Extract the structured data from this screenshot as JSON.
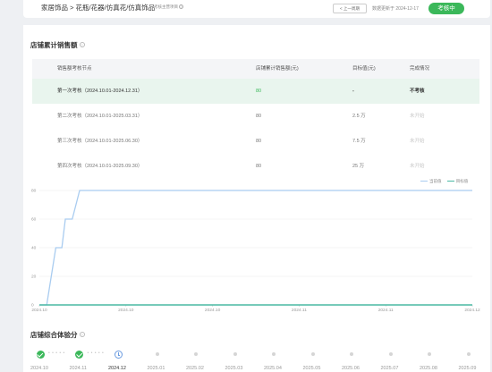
{
  "header": {
    "breadcrumb": "家居饰品 > 花瓶/花器/仿真花/仿真饰品",
    "hint_link": "考核主营项目",
    "prev_button": "< 上一周期",
    "update_text": "数据更新于 2024-12-17",
    "status_button": "考核中"
  },
  "sales_section": {
    "title": "店铺累计销售额",
    "columns": [
      "销售额考核节点",
      "店铺累计销售额(元)",
      "目标值(元)",
      "完成情况"
    ],
    "rows": [
      {
        "node": "第一次考核（2024.10.01-2024.12.31）",
        "sales": "80",
        "target": "-",
        "status": "不考核"
      },
      {
        "node": "第二次考核（2024.10.01-2025.03.31）",
        "sales": "80",
        "target": "2.5 万",
        "status": "未开始"
      },
      {
        "node": "第三次考核（2024.10.01-2025.06.30）",
        "sales": "80",
        "target": "7.5 万",
        "status": "未开始"
      },
      {
        "node": "第四次考核（2024.10.01-2025.09.30）",
        "sales": "80",
        "target": "25 万",
        "status": "未开始"
      }
    ]
  },
  "chart_data": {
    "type": "line",
    "x_tick_labels": [
      "2024.10",
      "2024.10",
      "2024.10",
      "2024.11",
      "2024.11",
      "2024.12"
    ],
    "y_ticks": [
      0,
      20,
      40,
      60,
      80
    ],
    "ylim": [
      0,
      80
    ],
    "legend": [
      "当前值",
      "目标值"
    ],
    "legend_position": "top-right",
    "grid": true,
    "series": [
      {
        "name": "当前值",
        "color": "#a9ccf0",
        "y": [
          0,
          0,
          40,
          40,
          60,
          60,
          80,
          80,
          80
        ]
      },
      {
        "name": "目标值",
        "color": "#4ab8a4",
        "y": [
          0,
          0,
          0,
          0,
          0,
          0,
          0,
          0,
          0
        ]
      }
    ]
  },
  "score_section": {
    "title": "店铺综合体验分",
    "timeline": [
      {
        "label": "2024.10",
        "state": "done"
      },
      {
        "label": "2024.11",
        "state": "done"
      },
      {
        "label": "2024.12",
        "state": "current"
      },
      {
        "label": "2025.01",
        "state": "future"
      },
      {
        "label": "2025.02",
        "state": "future"
      },
      {
        "label": "2025.03",
        "state": "future"
      },
      {
        "label": "2025.04",
        "state": "future"
      },
      {
        "label": "2025.05",
        "state": "future"
      },
      {
        "label": "2025.06",
        "state": "future"
      },
      {
        "label": "2025.07",
        "state": "future"
      },
      {
        "label": "2025.08",
        "state": "future"
      },
      {
        "label": "2025.09",
        "state": "future"
      }
    ]
  },
  "colors": {
    "accent_green": "#3bb85a",
    "current_blue": "#a9ccf0",
    "target_teal": "#4ab8a4"
  }
}
